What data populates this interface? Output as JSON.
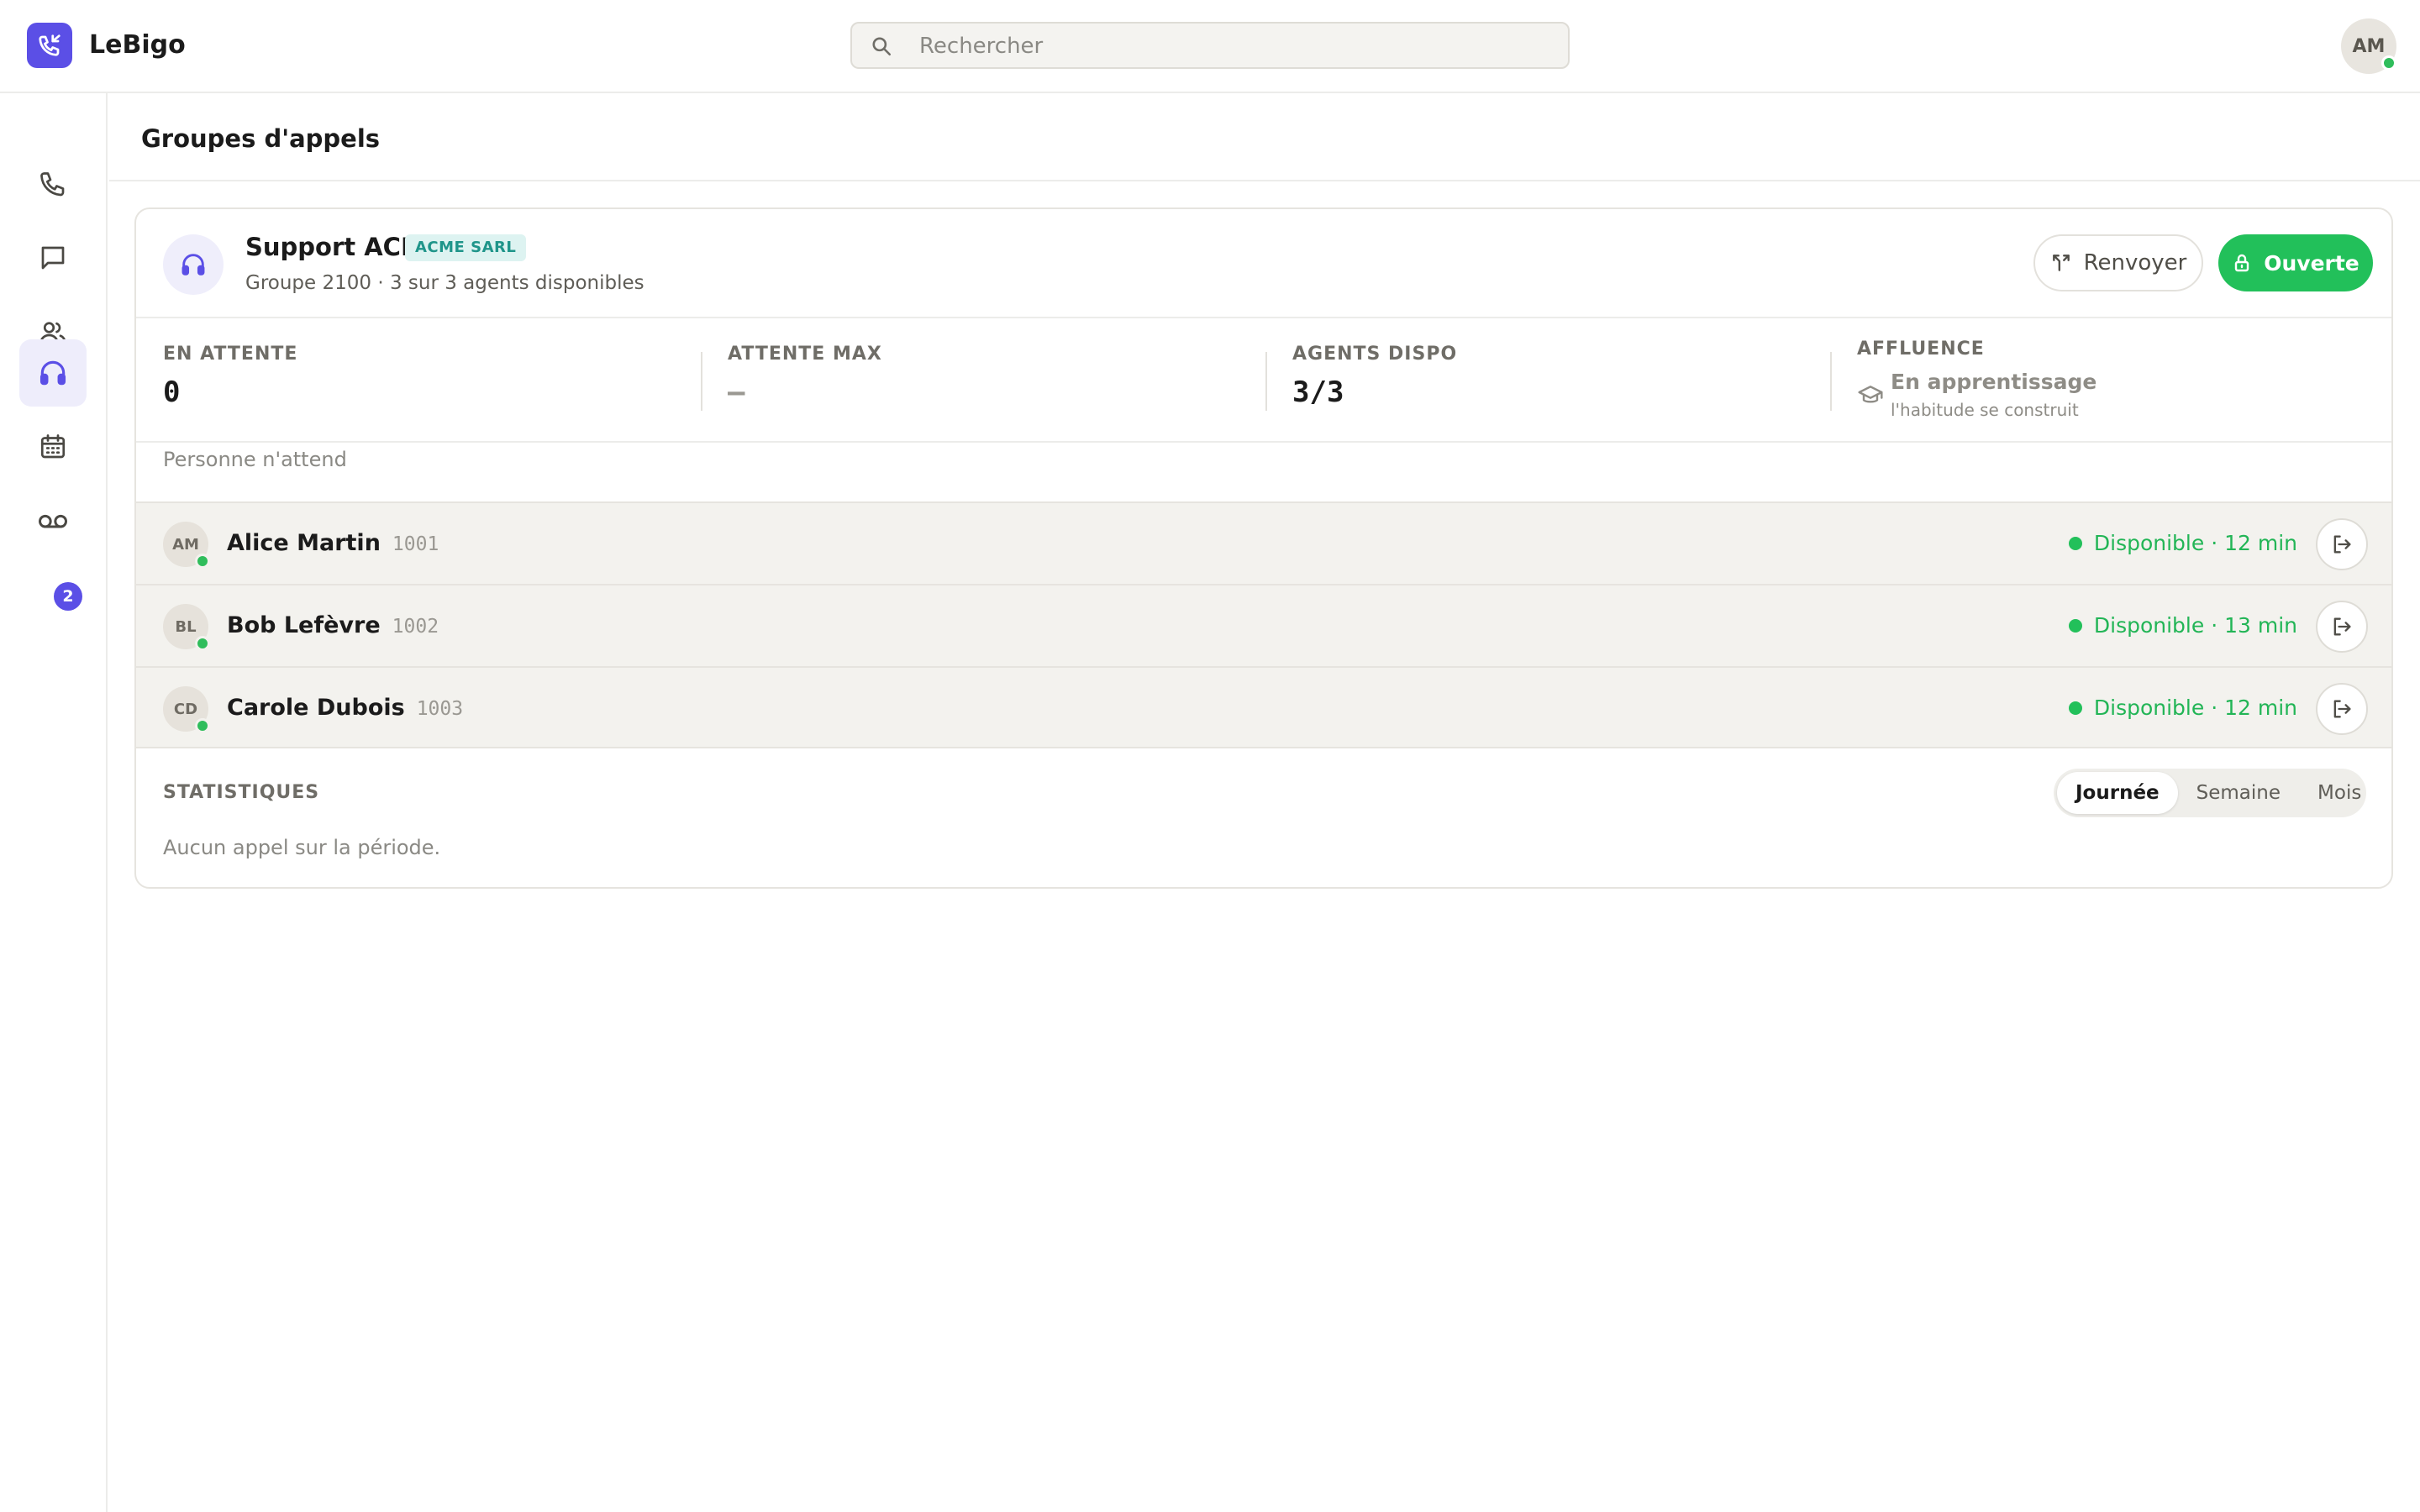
{
  "app": {
    "title": "LeBigo"
  },
  "search": {
    "placeholder": "Rechercher"
  },
  "user": {
    "initials": "AM"
  },
  "sidebar": {
    "items": [
      {
        "name": "calls",
        "icon": "phone-icon"
      },
      {
        "name": "messages",
        "icon": "chat-icon"
      },
      {
        "name": "contacts",
        "icon": "people-icon"
      },
      {
        "name": "call-groups",
        "icon": "headset-icon",
        "active": true
      },
      {
        "name": "calendar",
        "icon": "calendar-icon"
      },
      {
        "name": "voicemail",
        "icon": "voicemail-icon",
        "badge": "2"
      }
    ]
  },
  "page": {
    "title": "Groupes d'appels"
  },
  "group": {
    "name": "Support ACD",
    "tag": "ACME SARL",
    "subtitle": "Groupe 2100 · 3 sur 3 agents disponibles",
    "forward_label": "Renvoyer",
    "open_label": "Ouverte"
  },
  "stats": {
    "waiting_label": "EN ATTENTE",
    "waiting_value": "0",
    "maxwait_label": "ATTENTE MAX",
    "maxwait_value": "—",
    "agents_label": "AGENTS DISPO",
    "agents_value": "3/3",
    "affluence_label": "AFFLUENCE",
    "affluence_title": "En apprentissage",
    "affluence_sub": "l'habitude se construit"
  },
  "queue": {
    "empty_text": "Personne n'attend"
  },
  "agents": [
    {
      "initials": "AM",
      "name": "Alice Martin",
      "ext": "1001",
      "status": "Disponible · 12 min"
    },
    {
      "initials": "BL",
      "name": "Bob Lefèvre",
      "ext": "1002",
      "status": "Disponible · 13 min"
    },
    {
      "initials": "CD",
      "name": "Carole Dubois",
      "ext": "1003",
      "status": "Disponible · 12 min"
    }
  ],
  "statistics": {
    "title": "STATISTIQUES",
    "periods": [
      "Journée",
      "Semaine",
      "Mois"
    ],
    "selected_period": "Journée",
    "empty_text": "Aucun appel sur la période."
  },
  "colors": {
    "brand": "#5b4fe6",
    "open": "#22c05a",
    "available": "#22b556"
  }
}
